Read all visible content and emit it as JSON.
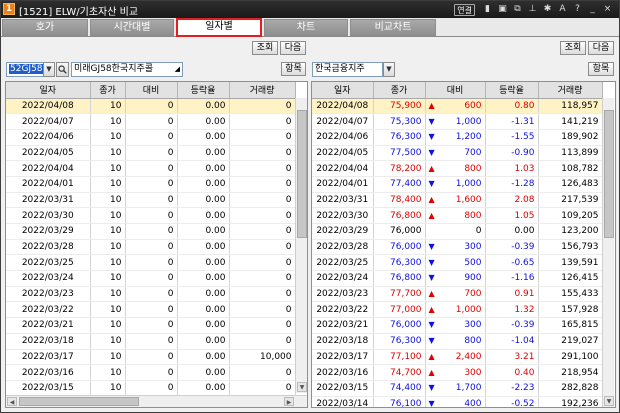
{
  "window": {
    "badge": "1",
    "title": "[1521] ELW/기초자산 비교",
    "link_label": "연결",
    "toolbar_icons": [
      "lock-icon",
      "window-icon",
      "copy-icon",
      "pin-icon",
      "settings-icon",
      "font-icon",
      "help-icon",
      "minimize-icon",
      "close-icon"
    ]
  },
  "tabs": [
    {
      "label": "호가",
      "active": false
    },
    {
      "label": "시간대별",
      "active": false
    },
    {
      "label": "일자별",
      "active": true
    },
    {
      "label": "차트",
      "active": false
    },
    {
      "label": "비교차트",
      "active": false
    }
  ],
  "left": {
    "query_label": "조회",
    "next_label": "다음",
    "code": "52GJ58",
    "name": "미래GJ58한국지주콜",
    "item_label": "항목",
    "columns": [
      "일자",
      "종가",
      "대비",
      "등락율",
      "거래량"
    ],
    "rows": [
      {
        "date": "2022/04/08",
        "close": "10",
        "change": "0",
        "rate": "0.00",
        "volume": "0",
        "dir": "none"
      },
      {
        "date": "2022/04/07",
        "close": "10",
        "change": "0",
        "rate": "0.00",
        "volume": "0",
        "dir": "none"
      },
      {
        "date": "2022/04/06",
        "close": "10",
        "change": "0",
        "rate": "0.00",
        "volume": "0",
        "dir": "none"
      },
      {
        "date": "2022/04/05",
        "close": "10",
        "change": "0",
        "rate": "0.00",
        "volume": "0",
        "dir": "none"
      },
      {
        "date": "2022/04/04",
        "close": "10",
        "change": "0",
        "rate": "0.00",
        "volume": "0",
        "dir": "none"
      },
      {
        "date": "2022/04/01",
        "close": "10",
        "change": "0",
        "rate": "0.00",
        "volume": "0",
        "dir": "none"
      },
      {
        "date": "2022/03/31",
        "close": "10",
        "change": "0",
        "rate": "0.00",
        "volume": "0",
        "dir": "none"
      },
      {
        "date": "2022/03/30",
        "close": "10",
        "change": "0",
        "rate": "0.00",
        "volume": "0",
        "dir": "none"
      },
      {
        "date": "2022/03/29",
        "close": "10",
        "change": "0",
        "rate": "0.00",
        "volume": "0",
        "dir": "none"
      },
      {
        "date": "2022/03/28",
        "close": "10",
        "change": "0",
        "rate": "0.00",
        "volume": "0",
        "dir": "none"
      },
      {
        "date": "2022/03/25",
        "close": "10",
        "change": "0",
        "rate": "0.00",
        "volume": "0",
        "dir": "none"
      },
      {
        "date": "2022/03/24",
        "close": "10",
        "change": "0",
        "rate": "0.00",
        "volume": "0",
        "dir": "none"
      },
      {
        "date": "2022/03/23",
        "close": "10",
        "change": "0",
        "rate": "0.00",
        "volume": "0",
        "dir": "none"
      },
      {
        "date": "2022/03/22",
        "close": "10",
        "change": "0",
        "rate": "0.00",
        "volume": "0",
        "dir": "none"
      },
      {
        "date": "2022/03/21",
        "close": "10",
        "change": "0",
        "rate": "0.00",
        "volume": "0",
        "dir": "none"
      },
      {
        "date": "2022/03/18",
        "close": "10",
        "change": "0",
        "rate": "0.00",
        "volume": "0",
        "dir": "none"
      },
      {
        "date": "2022/03/17",
        "close": "10",
        "change": "0",
        "rate": "0.00",
        "volume": "10,000",
        "dir": "none"
      },
      {
        "date": "2022/03/16",
        "close": "10",
        "change": "0",
        "rate": "0.00",
        "volume": "0",
        "dir": "none"
      },
      {
        "date": "2022/03/15",
        "close": "10",
        "change": "0",
        "rate": "0.00",
        "volume": "0",
        "dir": "none"
      }
    ]
  },
  "right": {
    "query_label": "조회",
    "next_label": "다음",
    "name": "한국금융지주",
    "item_label": "항목",
    "columns": [
      "일자",
      "종가",
      "대비",
      "등락율",
      "거래량"
    ],
    "rows": [
      {
        "date": "2022/04/08",
        "close": "75,900",
        "change": "600",
        "rate": "0.80",
        "volume": "118,957",
        "dir": "up"
      },
      {
        "date": "2022/04/07",
        "close": "75,300",
        "change": "1,000",
        "rate": "-1.31",
        "volume": "141,219",
        "dir": "down"
      },
      {
        "date": "2022/04/06",
        "close": "76,300",
        "change": "1,200",
        "rate": "-1.55",
        "volume": "189,902",
        "dir": "down"
      },
      {
        "date": "2022/04/05",
        "close": "77,500",
        "change": "700",
        "rate": "-0.90",
        "volume": "113,899",
        "dir": "down"
      },
      {
        "date": "2022/04/04",
        "close": "78,200",
        "change": "800",
        "rate": "1.03",
        "volume": "108,782",
        "dir": "up"
      },
      {
        "date": "2022/04/01",
        "close": "77,400",
        "change": "1,000",
        "rate": "-1.28",
        "volume": "126,483",
        "dir": "down"
      },
      {
        "date": "2022/03/31",
        "close": "78,400",
        "change": "1,600",
        "rate": "2.08",
        "volume": "217,539",
        "dir": "up"
      },
      {
        "date": "2022/03/30",
        "close": "76,800",
        "change": "800",
        "rate": "1.05",
        "volume": "109,205",
        "dir": "up"
      },
      {
        "date": "2022/03/29",
        "close": "76,000",
        "change": "0",
        "rate": "0.00",
        "volume": "123,200",
        "dir": "none"
      },
      {
        "date": "2022/03/28",
        "close": "76,000",
        "change": "300",
        "rate": "-0.39",
        "volume": "156,793",
        "dir": "down"
      },
      {
        "date": "2022/03/25",
        "close": "76,300",
        "change": "500",
        "rate": "-0.65",
        "volume": "139,591",
        "dir": "down"
      },
      {
        "date": "2022/03/24",
        "close": "76,800",
        "change": "900",
        "rate": "-1.16",
        "volume": "126,415",
        "dir": "down"
      },
      {
        "date": "2022/03/23",
        "close": "77,700",
        "change": "700",
        "rate": "0.91",
        "volume": "155,433",
        "dir": "up"
      },
      {
        "date": "2022/03/22",
        "close": "77,000",
        "change": "1,000",
        "rate": "1.32",
        "volume": "157,928",
        "dir": "up"
      },
      {
        "date": "2022/03/21",
        "close": "76,000",
        "change": "300",
        "rate": "-0.39",
        "volume": "165,815",
        "dir": "down"
      },
      {
        "date": "2022/03/18",
        "close": "76,300",
        "change": "800",
        "rate": "-1.04",
        "volume": "219,027",
        "dir": "down"
      },
      {
        "date": "2022/03/17",
        "close": "77,100",
        "change": "2,400",
        "rate": "3.21",
        "volume": "291,100",
        "dir": "up"
      },
      {
        "date": "2022/03/16",
        "close": "74,700",
        "change": "300",
        "rate": "0.40",
        "volume": "218,954",
        "dir": "up"
      },
      {
        "date": "2022/03/15",
        "close": "74,400",
        "change": "1,700",
        "rate": "-2.23",
        "volume": "282,828",
        "dir": "down"
      },
      {
        "date": "2022/03/14",
        "close": "76,100",
        "change": "400",
        "rate": "-0.52",
        "volume": "192,236",
        "dir": "down"
      }
    ]
  },
  "colors": {
    "up": "#e00000",
    "down": "#1010e0",
    "highlight_row": "#fff3c6",
    "active_tab_border": "#e02020",
    "badge": "#e8811a"
  }
}
